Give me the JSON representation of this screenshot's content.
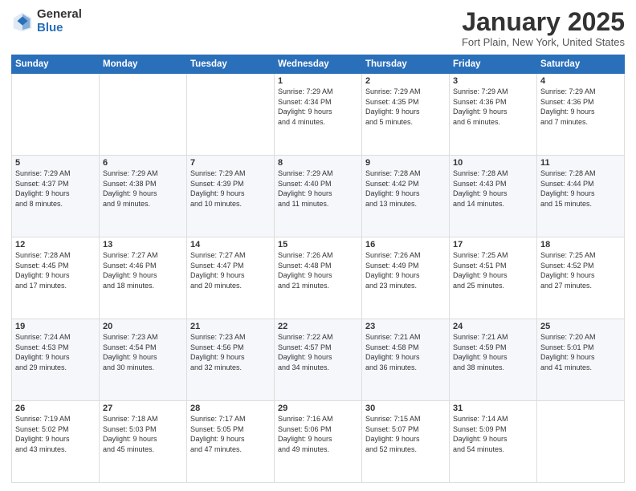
{
  "logo": {
    "general": "General",
    "blue": "Blue"
  },
  "title": "January 2025",
  "location": "Fort Plain, New York, United States",
  "days_header": [
    "Sunday",
    "Monday",
    "Tuesday",
    "Wednesday",
    "Thursday",
    "Friday",
    "Saturday"
  ],
  "weeks": [
    [
      {
        "day": "",
        "info": ""
      },
      {
        "day": "",
        "info": ""
      },
      {
        "day": "",
        "info": ""
      },
      {
        "day": "1",
        "info": "Sunrise: 7:29 AM\nSunset: 4:34 PM\nDaylight: 9 hours\nand 4 minutes."
      },
      {
        "day": "2",
        "info": "Sunrise: 7:29 AM\nSunset: 4:35 PM\nDaylight: 9 hours\nand 5 minutes."
      },
      {
        "day": "3",
        "info": "Sunrise: 7:29 AM\nSunset: 4:36 PM\nDaylight: 9 hours\nand 6 minutes."
      },
      {
        "day": "4",
        "info": "Sunrise: 7:29 AM\nSunset: 4:36 PM\nDaylight: 9 hours\nand 7 minutes."
      }
    ],
    [
      {
        "day": "5",
        "info": "Sunrise: 7:29 AM\nSunset: 4:37 PM\nDaylight: 9 hours\nand 8 minutes."
      },
      {
        "day": "6",
        "info": "Sunrise: 7:29 AM\nSunset: 4:38 PM\nDaylight: 9 hours\nand 9 minutes."
      },
      {
        "day": "7",
        "info": "Sunrise: 7:29 AM\nSunset: 4:39 PM\nDaylight: 9 hours\nand 10 minutes."
      },
      {
        "day": "8",
        "info": "Sunrise: 7:29 AM\nSunset: 4:40 PM\nDaylight: 9 hours\nand 11 minutes."
      },
      {
        "day": "9",
        "info": "Sunrise: 7:28 AM\nSunset: 4:42 PM\nDaylight: 9 hours\nand 13 minutes."
      },
      {
        "day": "10",
        "info": "Sunrise: 7:28 AM\nSunset: 4:43 PM\nDaylight: 9 hours\nand 14 minutes."
      },
      {
        "day": "11",
        "info": "Sunrise: 7:28 AM\nSunset: 4:44 PM\nDaylight: 9 hours\nand 15 minutes."
      }
    ],
    [
      {
        "day": "12",
        "info": "Sunrise: 7:28 AM\nSunset: 4:45 PM\nDaylight: 9 hours\nand 17 minutes."
      },
      {
        "day": "13",
        "info": "Sunrise: 7:27 AM\nSunset: 4:46 PM\nDaylight: 9 hours\nand 18 minutes."
      },
      {
        "day": "14",
        "info": "Sunrise: 7:27 AM\nSunset: 4:47 PM\nDaylight: 9 hours\nand 20 minutes."
      },
      {
        "day": "15",
        "info": "Sunrise: 7:26 AM\nSunset: 4:48 PM\nDaylight: 9 hours\nand 21 minutes."
      },
      {
        "day": "16",
        "info": "Sunrise: 7:26 AM\nSunset: 4:49 PM\nDaylight: 9 hours\nand 23 minutes."
      },
      {
        "day": "17",
        "info": "Sunrise: 7:25 AM\nSunset: 4:51 PM\nDaylight: 9 hours\nand 25 minutes."
      },
      {
        "day": "18",
        "info": "Sunrise: 7:25 AM\nSunset: 4:52 PM\nDaylight: 9 hours\nand 27 minutes."
      }
    ],
    [
      {
        "day": "19",
        "info": "Sunrise: 7:24 AM\nSunset: 4:53 PM\nDaylight: 9 hours\nand 29 minutes."
      },
      {
        "day": "20",
        "info": "Sunrise: 7:23 AM\nSunset: 4:54 PM\nDaylight: 9 hours\nand 30 minutes."
      },
      {
        "day": "21",
        "info": "Sunrise: 7:23 AM\nSunset: 4:56 PM\nDaylight: 9 hours\nand 32 minutes."
      },
      {
        "day": "22",
        "info": "Sunrise: 7:22 AM\nSunset: 4:57 PM\nDaylight: 9 hours\nand 34 minutes."
      },
      {
        "day": "23",
        "info": "Sunrise: 7:21 AM\nSunset: 4:58 PM\nDaylight: 9 hours\nand 36 minutes."
      },
      {
        "day": "24",
        "info": "Sunrise: 7:21 AM\nSunset: 4:59 PM\nDaylight: 9 hours\nand 38 minutes."
      },
      {
        "day": "25",
        "info": "Sunrise: 7:20 AM\nSunset: 5:01 PM\nDaylight: 9 hours\nand 41 minutes."
      }
    ],
    [
      {
        "day": "26",
        "info": "Sunrise: 7:19 AM\nSunset: 5:02 PM\nDaylight: 9 hours\nand 43 minutes."
      },
      {
        "day": "27",
        "info": "Sunrise: 7:18 AM\nSunset: 5:03 PM\nDaylight: 9 hours\nand 45 minutes."
      },
      {
        "day": "28",
        "info": "Sunrise: 7:17 AM\nSunset: 5:05 PM\nDaylight: 9 hours\nand 47 minutes."
      },
      {
        "day": "29",
        "info": "Sunrise: 7:16 AM\nSunset: 5:06 PM\nDaylight: 9 hours\nand 49 minutes."
      },
      {
        "day": "30",
        "info": "Sunrise: 7:15 AM\nSunset: 5:07 PM\nDaylight: 9 hours\nand 52 minutes."
      },
      {
        "day": "31",
        "info": "Sunrise: 7:14 AM\nSunset: 5:09 PM\nDaylight: 9 hours\nand 54 minutes."
      },
      {
        "day": "",
        "info": ""
      }
    ]
  ]
}
